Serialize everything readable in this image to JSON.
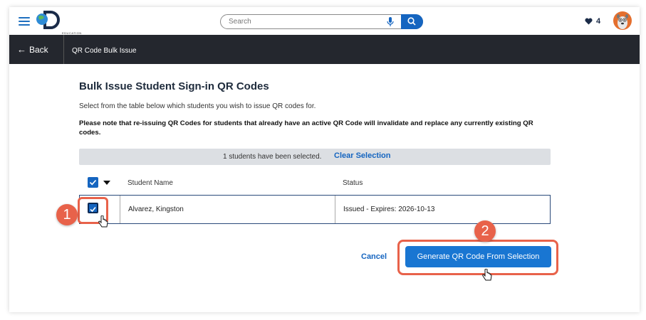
{
  "header": {
    "logo_text": "EDUCATION",
    "search_placeholder": "Search",
    "favorites_count": "4"
  },
  "nav": {
    "back_label": "Back",
    "title": "QR Code Bulk Issue"
  },
  "main": {
    "heading": "Bulk Issue Student Sign-in QR Codes",
    "description": "Select from the table below which students you wish to issue QR codes for.",
    "note": "Please note that re-issuing QR Codes for students that already have an active QR Code will invalidate and replace any currently existing QR codes.",
    "selection_text": "1 students have been selected.",
    "clear_selection": "Clear Selection",
    "table": {
      "columns": [
        "Student Name",
        "Status"
      ],
      "rows": [
        {
          "name": "Alvarez, Kingston",
          "status": "Issued - Expires: 2026-10-13",
          "checked": true
        }
      ]
    },
    "cancel_label": "Cancel",
    "generate_label": "Generate QR Code From Selection"
  },
  "annotations": {
    "step1": "1",
    "step2": "2"
  },
  "colors": {
    "accent": "#1565c0",
    "navbar": "#24272e",
    "highlight": "#e8624a"
  }
}
